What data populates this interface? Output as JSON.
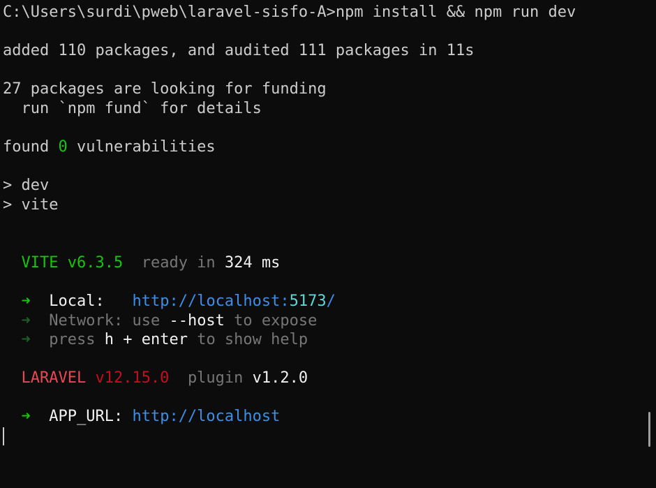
{
  "prompt": {
    "path": "C:\\Users\\surdi\\pweb\\laravel-sisfo-A>",
    "command": "npm install && npm run dev"
  },
  "install": {
    "added": "added 110 packages, and audited 111 packages in 11s",
    "funding": "27 packages are looking for funding",
    "fund_hint": "  run `npm fund` for details",
    "found_prefix": "found ",
    "vuln_count": "0",
    "found_suffix": " vulnerabilities"
  },
  "scripts": {
    "dev": "> dev",
    "vite": "> vite"
  },
  "vite": {
    "name": "VITE",
    "version": "v6.3.5",
    "ready": "ready in ",
    "ms_value": "324",
    "ms_unit": " ms",
    "arrow": "➜",
    "local_label": "Local:",
    "local_url_base": "http://localhost:",
    "local_url_port": "5173",
    "local_url_tail": "/",
    "network_label": "Network:",
    "network_use": " use ",
    "network_flag": "--host",
    "network_to": " to expose",
    "press": "press ",
    "key_h": "h + enter",
    "help": " to show help"
  },
  "laravel": {
    "name": "LARAVEL",
    "version": "v12.15.0",
    "plugin": "plugin ",
    "plugin_version": "v1.2.0",
    "app_url_label": "APP_URL",
    "app_url_sep": ": ",
    "app_url": "http://localhost"
  }
}
